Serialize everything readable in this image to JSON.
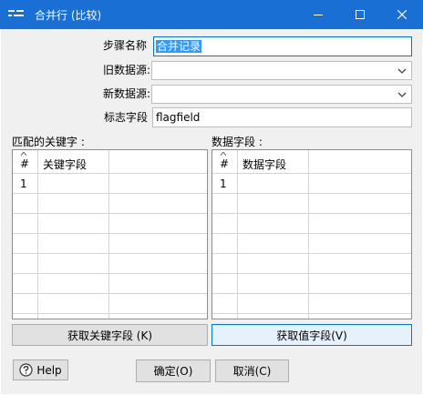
{
  "window": {
    "title": "合并行 (比较)",
    "minimize_icon": "minimize-icon",
    "maximize_icon": "maximize-icon",
    "close_icon": "close-icon",
    "titlebar_color": "#1a6fd4"
  },
  "form": {
    "step_name_label": "步骤名称",
    "step_name_value": "合并记录",
    "old_source_label": "旧数据源:",
    "old_source_value": "",
    "new_source_label": "新数据源:",
    "new_source_value": "",
    "flag_field_label": "标志字段",
    "flag_field_value": "flagfield"
  },
  "key_fields": {
    "label": "匹配的关键字 :",
    "columns": [
      "#",
      "关键字段"
    ],
    "rows": [
      [
        "1",
        ""
      ]
    ]
  },
  "value_fields": {
    "label": "数据字段 :",
    "columns": [
      "#",
      "数据字段"
    ],
    "rows": [
      [
        "1",
        ""
      ]
    ]
  },
  "buttons": {
    "get_keys": "获取关键字段 (K)",
    "get_values": "获取值字段(V)",
    "help": "Help",
    "ok": "确定(O)",
    "cancel": "取消(C)"
  }
}
